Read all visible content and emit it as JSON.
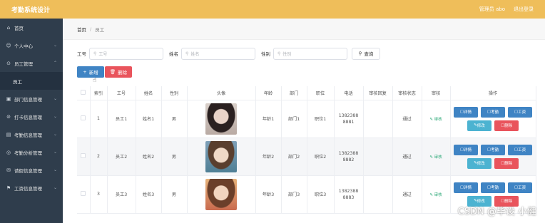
{
  "topbar": {
    "title": "考勤系统设计",
    "admin": "管理员 abo",
    "logout": "退出登录"
  },
  "sidebar": {
    "items": [
      {
        "label": "首页",
        "icon": "home-icon",
        "glyph": "⌂"
      },
      {
        "label": "个人中心",
        "icon": "user-icon",
        "glyph": "☺"
      },
      {
        "label": "员工管理",
        "icon": "people-icon",
        "glyph": "⊙"
      },
      {
        "label": "员工",
        "icon": "",
        "glyph": ""
      },
      {
        "label": "部门信息管理",
        "icon": "book-icon",
        "glyph": "▣"
      },
      {
        "label": "打卡信息管理",
        "icon": "clock-icon",
        "glyph": "⊘"
      },
      {
        "label": "考勤信息管理",
        "icon": "calendar-icon",
        "glyph": "▤"
      },
      {
        "label": "考勤分析管理",
        "icon": "chart-icon",
        "glyph": "◎"
      },
      {
        "label": "请假信息管理",
        "icon": "mail-icon",
        "glyph": "✉"
      },
      {
        "label": "工资信息管理",
        "icon": "flag-icon",
        "glyph": "⚑"
      }
    ]
  },
  "breadcrumb": {
    "home": "首页",
    "sep": "/",
    "current": "员工"
  },
  "filters": {
    "gonghao_label": "工号",
    "gonghao_placeholder": "工号",
    "name_label": "姓名",
    "name_placeholder": "姓名",
    "gender_label": "性别",
    "gender_placeholder": "性别",
    "search_label": "查询"
  },
  "actions": {
    "add": "新增",
    "delete": "删除"
  },
  "table": {
    "headers": [
      "",
      "索引",
      "工号",
      "姓名",
      "性别",
      "头像",
      "年龄",
      "部门",
      "职位",
      "电话",
      "审核回复",
      "审核状态",
      "审核",
      "操作"
    ],
    "rows": [
      {
        "index": "1",
        "gonghao": "员工1",
        "name": "姓名1",
        "gender": "男",
        "age": "年龄1",
        "dept": "部门1",
        "position": "职位1",
        "phone1": "1382388",
        "phone2": "8881",
        "reply": "",
        "status": "通过",
        "audit": "审核"
      },
      {
        "index": "2",
        "gonghao": "员工2",
        "name": "姓名2",
        "gender": "男",
        "age": "年龄2",
        "dept": "部门2",
        "position": "职位2",
        "phone1": "1382388",
        "phone2": "8882",
        "reply": "",
        "status": "通过",
        "audit": "审核"
      },
      {
        "index": "3",
        "gonghao": "员工3",
        "name": "姓名3",
        "gender": "男",
        "age": "年龄3",
        "dept": "部门3",
        "position": "职位3",
        "phone1": "1382388",
        "phone2": "8883",
        "reply": "",
        "status": "通过",
        "audit": "审核"
      }
    ],
    "ops": {
      "detail": "详情",
      "attendance": "考勤",
      "salary": "工资",
      "edit": "修改",
      "delete": "删除"
    }
  },
  "watermark": "CSDN @毕设 小健",
  "colors": {
    "topbar": "#efbe5a",
    "sidebar": "#2f3d4c",
    "primary": "#3f84c4",
    "danger": "#e9545c",
    "info": "#4cb3d1"
  }
}
